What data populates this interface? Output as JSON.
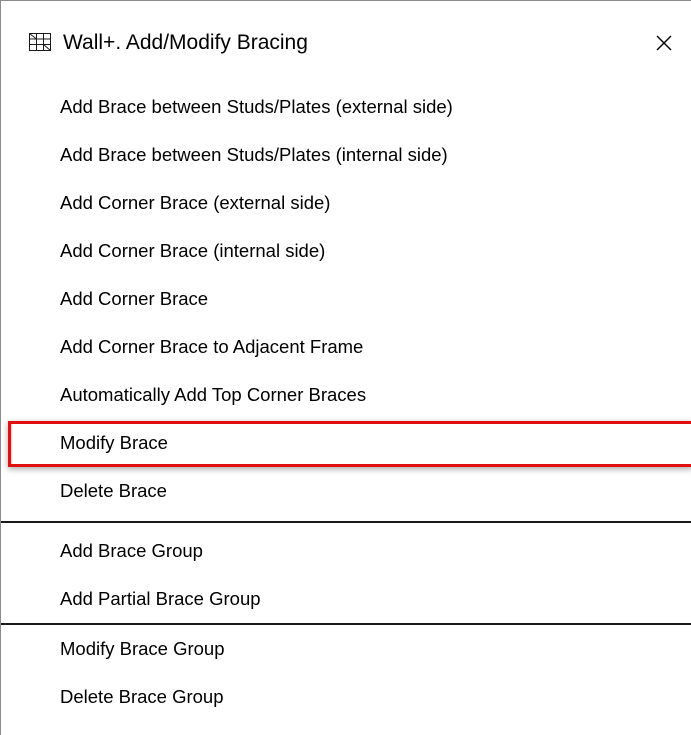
{
  "window": {
    "title": "Wall+. Add/Modify Bracing",
    "app_icon": "grid-frame-icon",
    "close_icon": "close-icon"
  },
  "menu": {
    "items": [
      {
        "label": "Add Brace between Studs/Plates (external side)"
      },
      {
        "label": "Add Brace between Studs/Plates (internal side)"
      },
      {
        "label": "Add Corner Brace (external side)"
      },
      {
        "label": "Add Corner Brace (internal side)"
      },
      {
        "label": "Add Corner Brace"
      },
      {
        "label": "Add Corner Brace to Adjacent Frame"
      },
      {
        "label": "Automatically Add Top Corner Braces"
      },
      {
        "label": "Modify Brace",
        "highlighted": true
      },
      {
        "label": "Delete Brace"
      },
      {
        "label": "Add Brace Group"
      },
      {
        "label": "Add Partial Brace Group"
      },
      {
        "label": "Modify Brace Group"
      },
      {
        "label": "Delete Brace Group"
      }
    ]
  },
  "colors": {
    "highlight_border": "#e01010",
    "separator": "#1a1a1a",
    "background": "#ffffff"
  }
}
